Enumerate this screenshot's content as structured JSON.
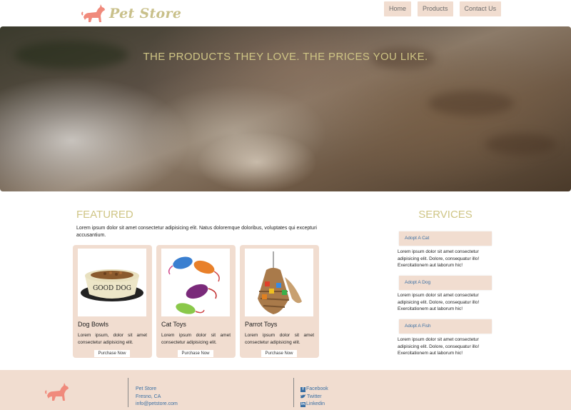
{
  "header": {
    "logo_text": "Pet Store",
    "nav": [
      {
        "label": "Home"
      },
      {
        "label": "Products"
      },
      {
        "label": "Contact Us"
      }
    ]
  },
  "hero": {
    "title": "THE PRODUCTS THEY LOVE. THE PRICES YOU LIKE."
  },
  "featured": {
    "title": "FEATURED",
    "description": "Lorem ipsum dolor sit amet consectetur adipisicing elit. Natus doloremque doloribus, voluptates qui excepturi accusantium.",
    "products": [
      {
        "name": "Dog Bowls",
        "description": "Lorem ipsum, dolor sit amet consectetur adipisicing elit.",
        "button": "Purchase Now",
        "bowl_label": "GOOD DOG"
      },
      {
        "name": "Cat Toys",
        "description": "Lorem ipsum dolor sit amet consectetur adipisicing elit.",
        "button": "Purchase Now"
      },
      {
        "name": "Parrot Toys",
        "description": "Lorem ipsum dolor sit amet consectetur adipisicing elit.",
        "button": "Purchase Now"
      }
    ]
  },
  "services": {
    "title": "SERVICES",
    "items": [
      {
        "label": "Adopt A Cat",
        "text": "Lorem ipsum dolor sit amet consectetur adipisicing elit. Dolore, consequatur illo! Exercitationem aut laborum hic!"
      },
      {
        "label": "Adopt A Dog",
        "text": "Lorem ipsum dolor sit amet consectetur adipisicing elit. Dolore, consequatur illo! Exercitationem aut laborum hic!"
      },
      {
        "label": "Adopt A Fish",
        "text": "Lorem ipsum dolor sit amet consectetur adipisicing elit. Dolore, consequatur illo! Exercitationem aut laborum hic!"
      }
    ]
  },
  "footer": {
    "address": [
      "Pet Store",
      "Fresno, CA",
      "info@petstore.com"
    ],
    "social": [
      {
        "label": "Facebook",
        "icon": "facebook-icon"
      },
      {
        "label": "Twitter",
        "icon": "twitter-icon"
      },
      {
        "label": "Linkedin",
        "icon": "linkedin-icon"
      }
    ]
  },
  "colors": {
    "accent_gold": "#cfc585",
    "peach": "#f1ddd0",
    "link_blue": "#3a6fa3",
    "logo_pink": "#f08a7c"
  }
}
